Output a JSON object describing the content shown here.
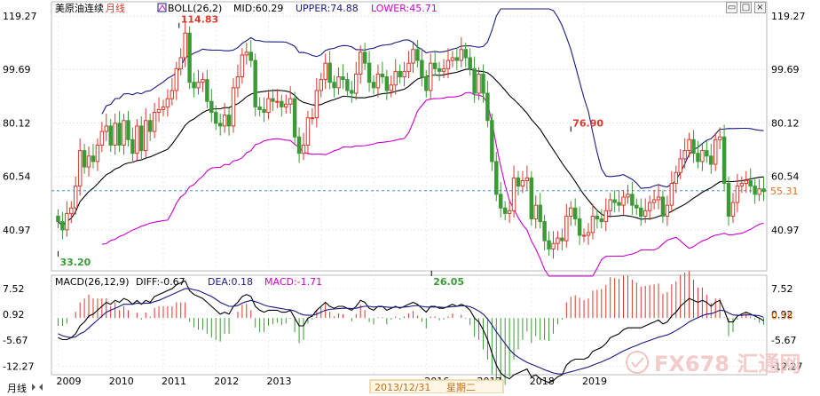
{
  "header": {
    "title": "美原油连续",
    "period": "月线",
    "indicator": "BOLL(26,2)",
    "mid": "MID:60.29",
    "upper": "UPPER:74.88",
    "lower": "LOWER:45.71"
  },
  "macd_header": {
    "name": "MACD(26,12,9)",
    "diff": "DIFF:-0.67",
    "dea": "DEA:0.18",
    "macd": "MACD:-1.71"
  },
  "footer": {
    "period_tab": "月线",
    "cursor_date": "2013/12/31",
    "cursor_weekday": "星期二"
  },
  "watermark": "FX678 汇通网",
  "colors": {
    "up": "#d9382c",
    "down": "#3a9a35",
    "mid": "#000000",
    "upper": "#1a1a80",
    "lower": "#cc00cc",
    "dea": "#1a1a80",
    "current_price": "#e07020",
    "annotation_high": "#d9382c",
    "annotation_low": "#3a9a35"
  },
  "chart_data": [
    {
      "type": "candlestick",
      "title": "美原油连续 月线",
      "y_ticks": [
        "119.27",
        "99.69",
        "80.12",
        "60.54",
        "40.97"
      ],
      "x_ticks": [
        "2009",
        "2010",
        "2011",
        "2012",
        "2013",
        "2016",
        "2017",
        "2018",
        "2019"
      ],
      "ylim": [
        26,
        119.27
      ],
      "current_price": "55.31",
      "annotations": [
        {
          "label": "114.83",
          "year": 2011.3,
          "value": 114.83
        },
        {
          "label": "33.20",
          "year": 2009.0,
          "value": 33.2
        },
        {
          "label": "26.05",
          "year": 2016.1,
          "value": 26.05
        },
        {
          "label": "76.90",
          "year": 2018.75,
          "value": 76.9
        }
      ],
      "close": [
        44,
        41,
        47,
        49,
        57,
        70,
        64,
        68,
        66,
        72,
        77,
        79,
        72,
        80,
        72,
        81,
        74,
        69,
        79,
        70,
        81,
        77,
        84,
        85,
        86,
        89,
        92,
        100,
        104,
        113,
        95,
        93,
        95,
        96,
        88,
        84,
        80,
        79,
        83,
        79,
        93,
        97,
        105,
        106,
        103,
        86,
        85,
        84,
        89,
        88,
        88,
        86,
        87,
        89,
        75,
        69,
        72,
        82,
        82,
        92,
        96,
        102,
        95,
        93,
        97,
        96,
        92,
        91,
        98,
        106,
        102,
        95,
        93,
        98,
        97,
        92,
        94,
        99,
        97,
        99,
        102,
        107,
        103,
        97,
        92,
        102,
        100,
        99,
        100,
        103,
        104,
        103,
        107,
        104,
        100,
        91,
        98,
        91,
        81,
        66,
        54,
        49,
        47,
        48,
        60,
        57,
        59,
        60,
        45,
        50,
        44,
        37,
        34,
        36,
        38,
        37,
        46,
        49,
        45,
        39,
        39,
        40,
        46,
        45,
        44,
        48,
        52,
        51,
        50,
        53,
        54,
        50,
        49,
        46,
        48,
        51,
        52,
        53,
        46,
        50,
        58,
        62,
        67,
        70,
        74,
        69,
        66,
        70,
        68,
        65,
        74,
        75,
        58,
        46,
        51,
        57,
        58,
        59,
        57,
        54,
        56,
        55
      ],
      "macd_y_ticks": [
        "7.52",
        "0.92",
        "-5.67",
        "-12.27"
      ],
      "macd_last_label": "0.58",
      "diff": [
        -5,
        -5.5,
        -5.5,
        -5,
        -4,
        -2,
        -1,
        0.5,
        1,
        2,
        3,
        4,
        3.5,
        4.5,
        4,
        5,
        4.5,
        3.5,
        4.5,
        3.5,
        4.5,
        4,
        5.5,
        6,
        6.5,
        7,
        7.5,
        8.5,
        9,
        9.5,
        7,
        6,
        5.5,
        5,
        4,
        3,
        2,
        1,
        1.5,
        1,
        3,
        4,
        5.5,
        6,
        5.5,
        3,
        2,
        1.5,
        2,
        2,
        2,
        1.5,
        1.5,
        2,
        0,
        -2,
        -2,
        0,
        0.5,
        2,
        3,
        4,
        3,
        2.5,
        3,
        3,
        2.5,
        2,
        3,
        4.5,
        4,
        2.5,
        2,
        3,
        3,
        2,
        2.5,
        3,
        2.5,
        3,
        3.5,
        4,
        3.5,
        2.5,
        1.5,
        3,
        3,
        2.5,
        2.5,
        3,
        3.5,
        3,
        3.5,
        3,
        2,
        0,
        -1,
        -3,
        -5.5,
        -9,
        -12,
        -14,
        -15,
        -15.5,
        -14.5,
        -14,
        -13.5,
        -13,
        -15,
        -14.5,
        -15.5,
        -16,
        -16.5,
        -16,
        -15,
        -14.5,
        -12,
        -11,
        -10.5,
        -10.5,
        -10.5,
        -10,
        -8.5,
        -8,
        -7.5,
        -6.5,
        -5,
        -4.5,
        -4,
        -3,
        -2.5,
        -2.5,
        -2.5,
        -2.5,
        -2,
        -1.5,
        -1,
        -0.5,
        -1.5,
        -1,
        0.5,
        1.5,
        3,
        4,
        5,
        4.5,
        4,
        4.5,
        4,
        3,
        4,
        4.5,
        2,
        -1,
        -1,
        0.5,
        1,
        1.5,
        1,
        0.5,
        0,
        -0.67
      ],
      "dea": [
        -4,
        -4.5,
        -4.8,
        -5,
        -4.8,
        -4,
        -3.5,
        -2.5,
        -1.5,
        -0.5,
        0.5,
        1.5,
        2,
        2.5,
        3,
        3.5,
        3.5,
        3.5,
        3.8,
        3.7,
        3.8,
        3.8,
        4.2,
        4.5,
        5,
        5.5,
        6,
        6.5,
        7,
        7.5,
        7.5,
        7.2,
        7,
        6.5,
        6,
        5.5,
        4.8,
        4,
        3.5,
        3,
        3,
        3.2,
        3.8,
        4.2,
        4.5,
        4.2,
        3.8,
        3.3,
        3,
        2.8,
        2.6,
        2.4,
        2.2,
        2.1,
        1.8,
        1.2,
        0.8,
        0.7,
        0.7,
        1,
        1.5,
        2,
        2.2,
        2.3,
        2.4,
        2.5,
        2.5,
        2.4,
        2.5,
        2.8,
        3,
        3,
        2.8,
        2.9,
        2.9,
        2.8,
        2.7,
        2.8,
        2.7,
        2.8,
        2.9,
        3.1,
        3.2,
        3,
        2.8,
        2.8,
        2.8,
        2.8,
        2.7,
        2.8,
        2.9,
        3,
        3.1,
        3.1,
        2.9,
        2.4,
        1.8,
        1,
        -0.2,
        -1.8,
        -3.5,
        -5,
        -6.5,
        -8,
        -9.2,
        -10,
        -10.7,
        -11.3,
        -11.8,
        -12.2,
        -12.7,
        -13.2,
        -13.6,
        -14,
        -14.2,
        -14.3,
        -14,
        -13.7,
        -13.4,
        -13.1,
        -12.8,
        -12.5,
        -12,
        -11.6,
        -11.2,
        -10.7,
        -10.2,
        -9.6,
        -9,
        -8.4,
        -7.9,
        -7.4,
        -7,
        -6.5,
        -6.1,
        -5.7,
        -5.3,
        -4.9,
        -4.6,
        -4.3,
        -3.8,
        -3.2,
        -2.5,
        -1.8,
        -1,
        -0.4,
        0.1,
        0.6,
        1,
        1.1,
        1.5,
        2,
        1.9,
        1.3,
        0.8,
        0.7,
        0.7,
        0.8,
        0.8,
        0.7,
        0.6,
        0.18
      ]
    }
  ]
}
